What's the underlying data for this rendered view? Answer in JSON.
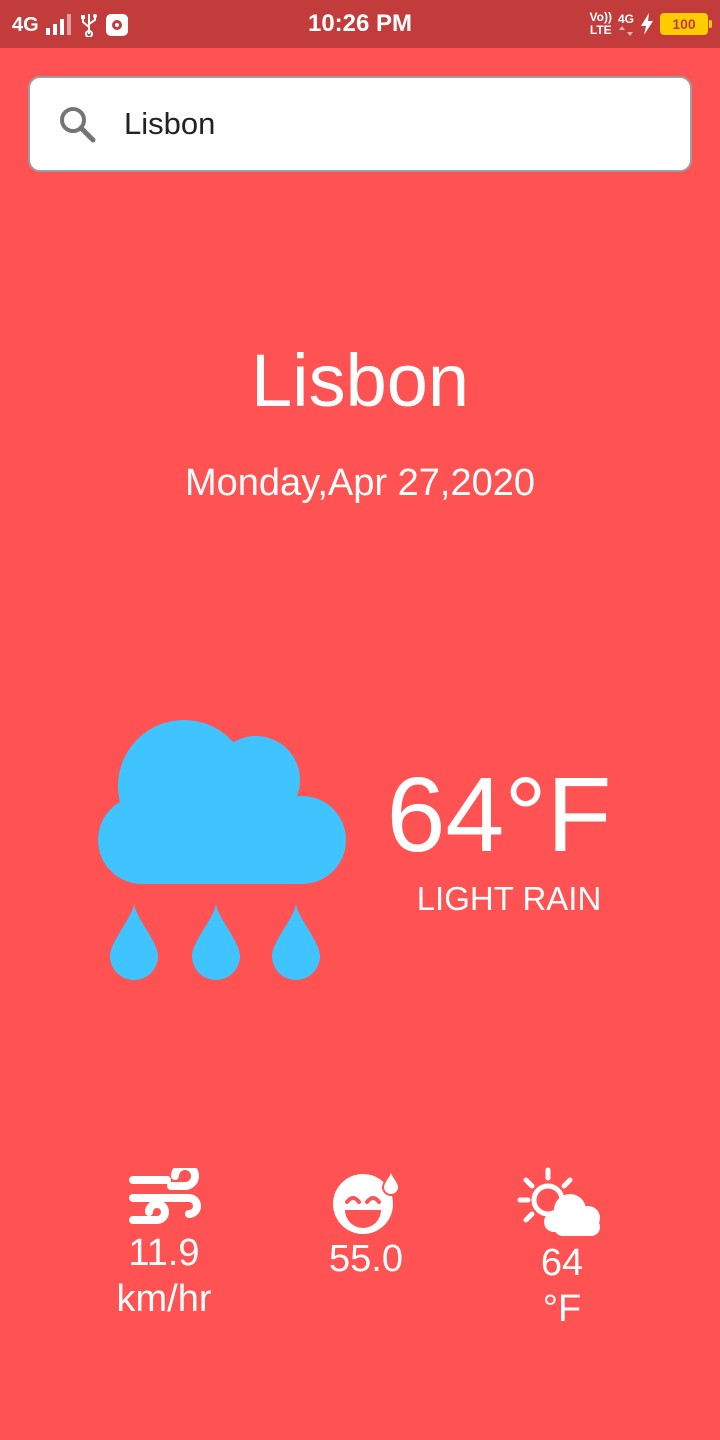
{
  "status_bar": {
    "network_left": "4G",
    "time": "10:26 PM",
    "volte_top": "Vo))",
    "volte_bottom": "LTE",
    "network_right": "4G",
    "battery": "100"
  },
  "search": {
    "value": "Lisbon",
    "placeholder": ""
  },
  "location": {
    "city": "Lisbon",
    "date": "Monday,Apr 27,2020"
  },
  "current": {
    "temperature": "64°F",
    "condition": "LIGHT RAIN",
    "icon": "cloud-rain-icon"
  },
  "details": {
    "wind_speed": "11.9",
    "wind_unit": "km/hr",
    "humidity": "55.0",
    "feels_like": "64",
    "feels_like_unit": "°F"
  },
  "colors": {
    "background": "#ff5252",
    "status_bar": "#c23c3c",
    "rain_icon": "#40c4ff",
    "text": "#ffffff"
  }
}
